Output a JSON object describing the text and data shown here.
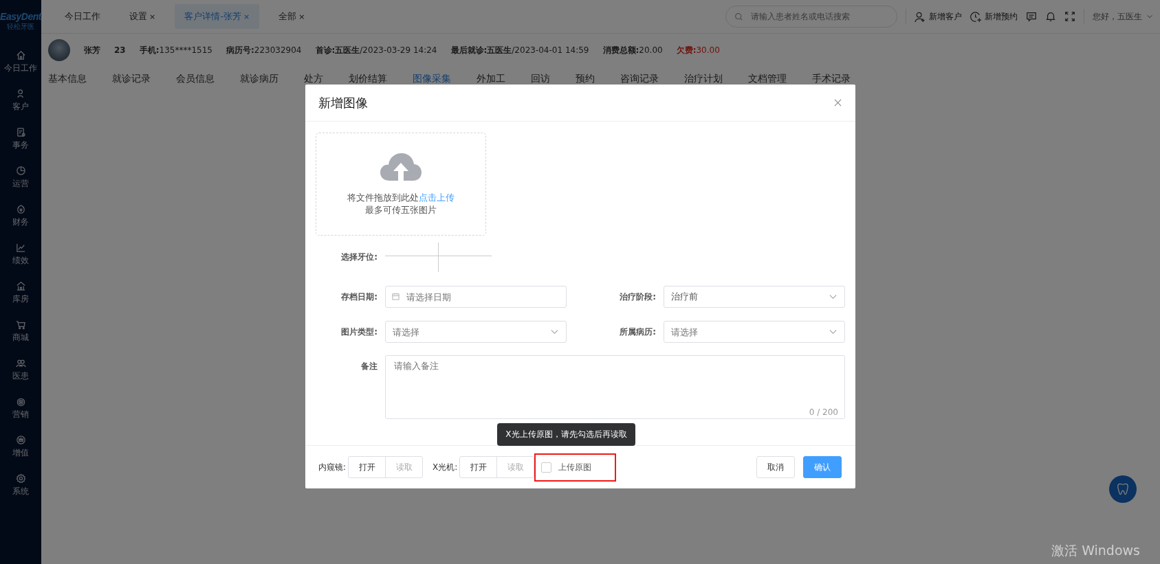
{
  "logo": {
    "title": "EasyDent",
    "subtitle": "轻松牙医"
  },
  "sidebar": {
    "items": [
      {
        "label": "今日工作"
      },
      {
        "label": "客户"
      },
      {
        "label": "事务"
      },
      {
        "label": "运营"
      },
      {
        "label": "财务"
      },
      {
        "label": "绩效"
      },
      {
        "label": "库房"
      },
      {
        "label": "商城"
      },
      {
        "label": "医患"
      },
      {
        "label": "营销"
      },
      {
        "label": "增值"
      },
      {
        "label": "系统"
      }
    ]
  },
  "tabs": [
    {
      "label": "今日工作",
      "selected": false
    },
    {
      "label": "设置",
      "close": "×",
      "selected": false
    },
    {
      "label": "客户详情-张芳",
      "close": "×",
      "selected": true
    },
    {
      "label": "全部",
      "close": "×",
      "selected": false
    }
  ],
  "search": {
    "placeholder": "请输入患者姓名或电话搜索"
  },
  "header_actions": [
    {
      "label": "新增客户"
    },
    {
      "label": "新增预约"
    }
  ],
  "user": {
    "greeting": "您好，五医生"
  },
  "patient": {
    "name": "张芳",
    "age": "23",
    "fields": [
      {
        "label": "手机:",
        "value": "135****1515",
        "kind": "normal"
      },
      {
        "label": "病历号:",
        "value": "223032904",
        "kind": "normal"
      },
      {
        "label": "首诊:五医生",
        "value": "/2023-03-29 14:24",
        "kind": "normal"
      },
      {
        "label": "最后就诊:五医生",
        "value": "/2023-04-01 14:59",
        "kind": "normal"
      },
      {
        "label": "消费总额:",
        "value": "20.00",
        "kind": "normal"
      },
      {
        "label": "欠费:",
        "value": "30.00",
        "kind": "alert"
      }
    ]
  },
  "detail_tabs": [
    {
      "label": "基本信息",
      "selected": false
    },
    {
      "label": "就诊记录",
      "selected": false
    },
    {
      "label": "会员信息",
      "selected": false
    },
    {
      "label": "就诊病历",
      "selected": false
    },
    {
      "label": "处方",
      "selected": false
    },
    {
      "label": "划价结算",
      "selected": false
    },
    {
      "label": "图像采集",
      "selected": true
    },
    {
      "label": "外加工",
      "selected": false
    },
    {
      "label": "回访",
      "selected": false
    },
    {
      "label": "预约",
      "selected": false
    },
    {
      "label": "咨询记录",
      "selected": false
    },
    {
      "label": "治疗计划",
      "selected": false
    },
    {
      "label": "文档管理",
      "selected": false
    },
    {
      "label": "手术记录",
      "selected": false
    }
  ],
  "dialog": {
    "title": "新增图像",
    "upload": {
      "text": "将文件拖放到此处",
      "link": "点击上传",
      "hint": "最多可传五张图片"
    },
    "tooth_label": "选择牙位:",
    "fields": [
      {
        "label": "存档日期:",
        "kind": "date",
        "placeholder": "请选择日期"
      },
      {
        "label": "治疗阶段:",
        "kind": "select",
        "value": "治疗前"
      },
      {
        "label": "图片类型:",
        "kind": "select",
        "placeholder": "请选择"
      },
      {
        "label": "所属病历:",
        "kind": "select",
        "placeholder": "请选择"
      }
    ],
    "remark": {
      "label": "备注",
      "placeholder": "请输入备注",
      "counter": "0 / 200"
    },
    "devices": [
      {
        "label": "内窥镜:",
        "buttons": [
          {
            "label": "打开",
            "disabled": false
          },
          {
            "label": "读取",
            "disabled": true
          }
        ]
      },
      {
        "label": "X光机:",
        "buttons": [
          {
            "label": "打开",
            "disabled": false
          },
          {
            "label": "读取",
            "disabled": true
          }
        ]
      }
    ],
    "upload_original": {
      "label": "上传原图",
      "checked": false,
      "highlighted": true
    },
    "tooltip": "X光上传原图，请先勾选后再读取",
    "buttons": [
      {
        "label": "取消",
        "kind": "default"
      },
      {
        "label": "确认",
        "kind": "primary"
      }
    ]
  },
  "os_notice": "激活 Windows"
}
